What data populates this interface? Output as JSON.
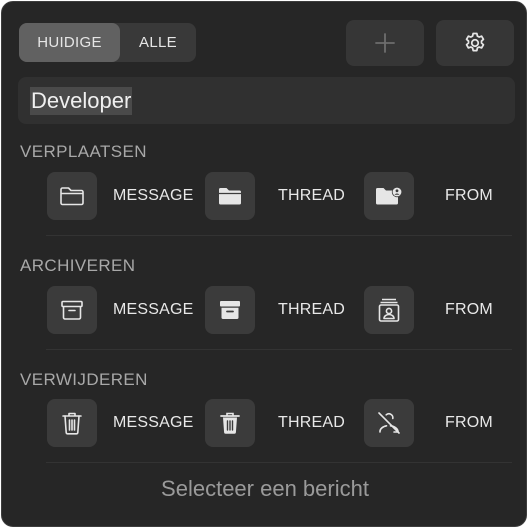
{
  "segments": {
    "current": "HUIDIGE",
    "all": "ALLE"
  },
  "toolbar": {
    "add_icon": "plus-icon",
    "settings_icon": "gear-icon"
  },
  "search": {
    "value": "Developer"
  },
  "sections": {
    "move": {
      "title": "VERPLAATSEN",
      "message": "MESSAGE",
      "thread": "THREAD",
      "from": "FROM"
    },
    "archive": {
      "title": "ARCHIVEREN",
      "message": "MESSAGE",
      "thread": "THREAD",
      "from": "FROM"
    },
    "delete": {
      "title": "VERWIJDEREN",
      "message": "MESSAGE",
      "thread": "THREAD",
      "from": "FROM"
    }
  },
  "footer": {
    "text": "Selecteer een bericht"
  },
  "colors": {
    "panel": "#262626",
    "button": "#3b3b3b",
    "active_segment": "#616161"
  }
}
